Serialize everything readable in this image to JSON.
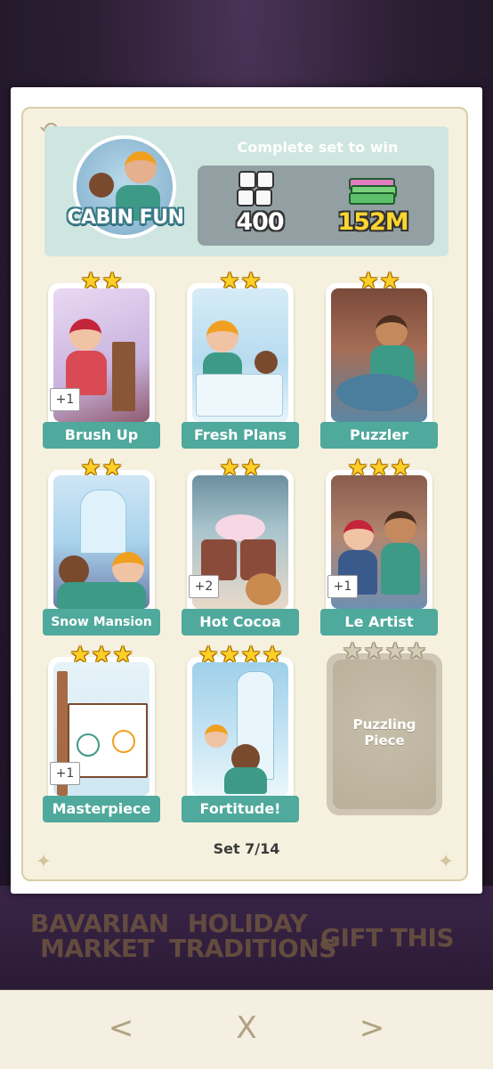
{
  "background": {
    "labels": [
      "BAVARIAN MARKET",
      "HOLIDAY TRADITIONS",
      "GIFT THIS"
    ]
  },
  "header": {
    "set_name": "CABIN FUN",
    "complete_text": "Complete set to win",
    "reward_dice": "400",
    "reward_money": "152M"
  },
  "cards": [
    {
      "name": "Brush Up",
      "stars": 2,
      "badge": "+1"
    },
    {
      "name": "Fresh Plans",
      "stars": 2,
      "badge": ""
    },
    {
      "name": "Puzzler",
      "stars": 2,
      "badge": ""
    },
    {
      "name": "Snow Mansion",
      "stars": 2,
      "badge": ""
    },
    {
      "name": "Hot Cocoa",
      "stars": 2,
      "badge": "+2"
    },
    {
      "name": "Le Artist",
      "stars": 3,
      "badge": "+1"
    },
    {
      "name": "Masterpiece",
      "stars": 3,
      "badge": "+1"
    },
    {
      "name": "Fortitude!",
      "stars": 4,
      "badge": ""
    },
    {
      "name": "Puzzling Piece",
      "stars": 4,
      "badge": "",
      "locked": true
    }
  ],
  "footer": {
    "set_count": "Set 7/14"
  },
  "nav": {
    "prev": "<",
    "close": "X",
    "next": ">"
  },
  "colors": {
    "teal_label": "#4fa99c",
    "star_gold": "#ffcf26",
    "money_yellow": "#ffd52e"
  }
}
